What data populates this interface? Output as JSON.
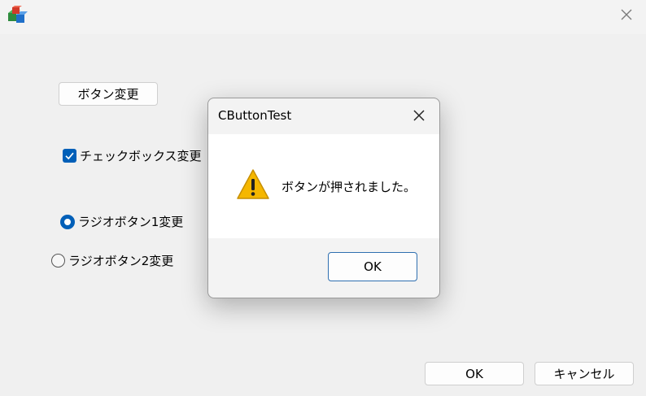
{
  "window": {
    "title_icon": "app-icon",
    "close_icon": "close-icon"
  },
  "form": {
    "change_button_label": "ボタン変更",
    "checkbox": {
      "label": "チェックボックス変更",
      "checked": true
    },
    "radio1": {
      "label": "ラジオボタン1変更",
      "selected": true
    },
    "radio2": {
      "label": "ラジオボタン2変更",
      "selected": false
    },
    "ok_label": "OK",
    "cancel_label": "キャンセル"
  },
  "dialog": {
    "title": "CButtonTest",
    "message": "ボタンが押されました。",
    "icon": "warning-icon",
    "ok_label": "OK"
  },
  "colors": {
    "accent": "#005fb8",
    "warning": "#f5b700"
  }
}
